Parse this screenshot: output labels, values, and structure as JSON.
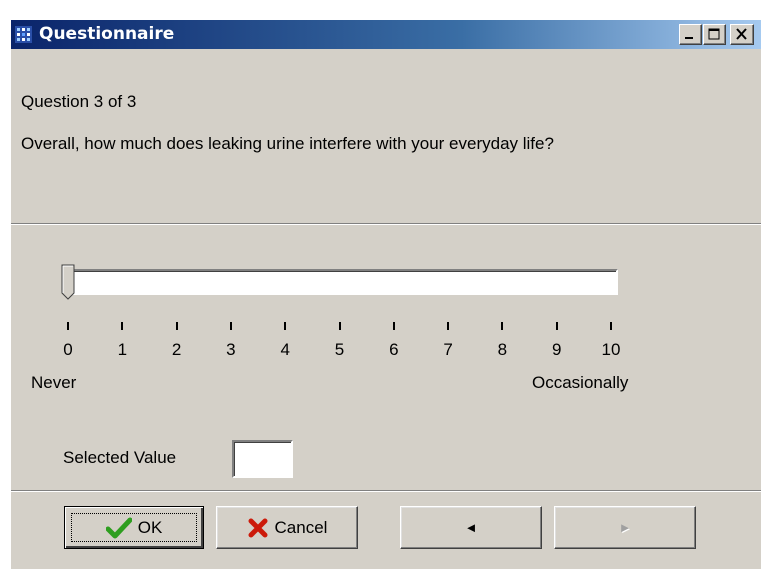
{
  "window": {
    "title": "Questionnaire",
    "icon": "questionnaire-app-icon",
    "controls": [
      "minimize-icon",
      "maximize-icon",
      "close-icon"
    ]
  },
  "question": {
    "counter": "Question 3 of 3",
    "text": "Overall, how much does leaking urine interfere with your everyday life?"
  },
  "scale": {
    "tick_labels": [
      "0",
      "1",
      "2",
      "3",
      "4",
      "5",
      "6",
      "7",
      "8",
      "9",
      "10"
    ],
    "min_label": "Never",
    "max_label": "Occasionally",
    "value": 0,
    "min": 0,
    "max": 10
  },
  "selected": {
    "label": "Selected Value",
    "value": ""
  },
  "buttons": {
    "ok": "OK",
    "cancel": "Cancel",
    "prev": "◄",
    "next": "►"
  },
  "colors": {
    "title_start": "#0a246a",
    "title_end": "#a6caf0",
    "face": "#d4d0c8",
    "ok_check": "#2e9e1f",
    "cancel_x": "#cc1a0a"
  }
}
